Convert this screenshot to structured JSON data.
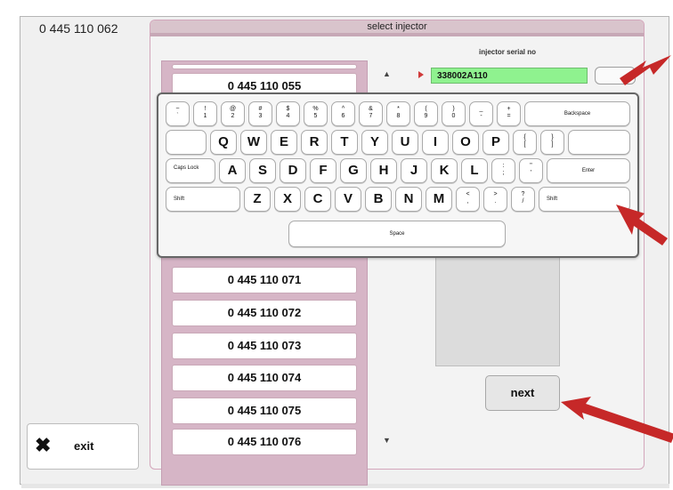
{
  "left_panel": {
    "injector_code": "0 445 110  062",
    "exit_label": "exit",
    "exit_icon": "close-icon"
  },
  "main": {
    "title": "select injector",
    "serial_label": "injector serial no",
    "serial_value": "338002A110",
    "list_items": [
      "0 445 110 055",
      "0 445 110 071",
      "0 445 110 072",
      "0 445 110 073",
      "0 445 110 074",
      "0 445 110 075",
      "0 445 110 076"
    ],
    "next_label": "next"
  },
  "keyboard": {
    "row1": [
      [
        "~",
        "`"
      ],
      [
        "!",
        "1"
      ],
      [
        "@",
        "2"
      ],
      [
        "#",
        "3"
      ],
      [
        "$",
        "4"
      ],
      [
        "%",
        "5"
      ],
      [
        "^",
        "6"
      ],
      [
        "&",
        "7"
      ],
      [
        "*",
        "8"
      ],
      [
        "(",
        "9"
      ],
      [
        ")",
        "0"
      ],
      [
        "_",
        "-"
      ],
      [
        "+",
        "="
      ]
    ],
    "backspace": "Backspace",
    "row2": [
      "Q",
      "W",
      "E",
      "R",
      "T",
      "Y",
      "U",
      "I",
      "O",
      "P"
    ],
    "row2_sym": [
      [
        "{",
        "["
      ],
      [
        "}",
        "]"
      ]
    ],
    "caps": "Caps Lock",
    "row3": [
      "A",
      "S",
      "D",
      "F",
      "G",
      "H",
      "J",
      "K",
      "L"
    ],
    "row3_sym": [
      [
        ":",
        ";"
      ],
      [
        "\"",
        "'"
      ]
    ],
    "enter": "Enter",
    "shift": "Shift",
    "row4": [
      "Z",
      "X",
      "C",
      "V",
      "B",
      "N",
      "M"
    ],
    "row4_sym": [
      [
        "<",
        ","
      ],
      [
        ">",
        "."
      ],
      [
        "?",
        "/"
      ]
    ],
    "space": "Space"
  },
  "colors": {
    "arrow": "#c62828",
    "serial_bg": "#8ff28f",
    "list_bg": "#d6b5c6"
  }
}
